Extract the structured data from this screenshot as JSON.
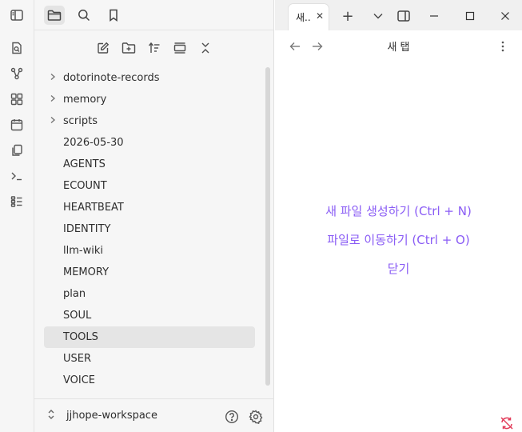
{
  "ribbon": {
    "icons": [
      "sidebar-toggle-icon",
      "quick-switcher-icon",
      "graph-view-icon",
      "canvas-icon",
      "daily-note-icon",
      "templates-icon",
      "terminal-icon",
      "bases-icon"
    ]
  },
  "sidebar": {
    "tabs": [
      "files-icon",
      "search-icon",
      "bookmarks-icon"
    ],
    "nav_actions": [
      "new-note-icon",
      "new-folder-icon",
      "sort-icon",
      "auto-reveal-icon",
      "collapse-all-icon"
    ],
    "tree": [
      {
        "label": "dotorinote-records",
        "folder": true
      },
      {
        "label": "memory",
        "folder": true
      },
      {
        "label": "scripts",
        "folder": true
      },
      {
        "label": "2026-05-30",
        "folder": false
      },
      {
        "label": "AGENTS",
        "folder": false
      },
      {
        "label": "ECOUNT",
        "folder": false
      },
      {
        "label": "HEARTBEAT",
        "folder": false
      },
      {
        "label": "IDENTITY",
        "folder": false
      },
      {
        "label": "llm-wiki",
        "folder": false
      },
      {
        "label": "MEMORY",
        "folder": false
      },
      {
        "label": "plan",
        "folder": false
      },
      {
        "label": "SOUL",
        "folder": false
      },
      {
        "label": "TOOLS",
        "folder": false,
        "selected": true
      },
      {
        "label": "USER",
        "folder": false
      },
      {
        "label": "VOICE",
        "folder": false
      }
    ],
    "vault_name": "jjhope-workspace"
  },
  "tabstrip": {
    "tab_label": "새..",
    "tab_close": "✕",
    "new_tab": "+",
    "tab_list": "⌄"
  },
  "main": {
    "title": "새 탭",
    "actions": {
      "create_file": "새 파일 생성하기 (Ctrl + N)",
      "go_to_file": "파일로 이동하기 (Ctrl + O)",
      "close": "닫기"
    }
  },
  "colors": {
    "accent": "#8a5cf5",
    "sync_error": "#e23d5a",
    "selection_bg": "#e5e5e5"
  }
}
